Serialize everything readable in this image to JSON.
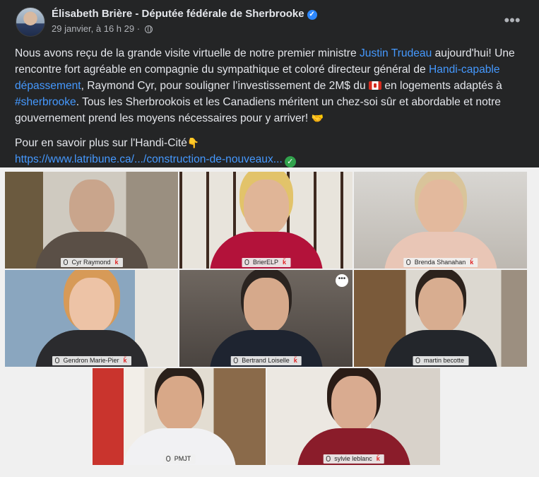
{
  "post": {
    "author": "Élisabeth Brière - Députée fédérale de Sherbrooke",
    "timestamp": "29 janvier, à 16 h 29",
    "separator": "·",
    "more_label": "•••",
    "verified_glyph": "✓",
    "paragraph1": {
      "t1": "Nous avons reçu de la grande visite virtuelle de notre premier ministre ",
      "link1": "Justin Trudeau",
      "t2": " aujourd'hui! Une rencontre fort agréable en compagnie du sympathique et coloré directeur général de ",
      "link2": "Handi-capable dépassement",
      "t3": ", Raymond Cyr, pour souligner l’investissement de 2M$ du ",
      "t4": " en logements adaptés à ",
      "link3": "#sherbrooke",
      "t5": ". Tous les Sherbrookois et les Canadiens méritent un chez-soi sûr et abordable et notre gouvernement prend les moyens nécessaires pour y arriver! ",
      "emoji_end": "🤝"
    },
    "paragraph2": {
      "text": "Pour en savoir plus sur l'Handi-Cité",
      "emoji": "👇",
      "url": "https://www.latribune.ca/.../construction-de-nouveaux...",
      "check_glyph": "✓"
    }
  },
  "icons": {
    "verified": "verified-badge-icon",
    "globe": "globe-icon",
    "more": "more-options-icon",
    "flag": "canada-flag-icon",
    "handshake": "handshake-emoji",
    "pointing": "pointing-down-emoji",
    "check": "check-mark-icon",
    "mic": "microphone-icon",
    "muted": "muted-icon"
  },
  "video_call": {
    "participants": [
      {
        "name": "Cyr Raymond",
        "muted": true
      },
      {
        "name": "BrierELP",
        "muted": true
      },
      {
        "name": "Brenda Shanahan",
        "muted": true
      },
      {
        "name": "Gendron Marie-Pier",
        "muted": true
      },
      {
        "name": "Bertrand Loiselle",
        "muted": true
      },
      {
        "name": "martin becotte",
        "muted": false
      },
      {
        "name": "PMJT",
        "muted": false,
        "active_speaker": true
      },
      {
        "name": "sylvie leblanc",
        "muted": true
      }
    ],
    "muted_glyph": "ǩ",
    "tile_menu_label": "•••"
  },
  "colors": {
    "background": "#242526",
    "text": "#e4e6eb",
    "secondary_text": "#b0b3b8",
    "link": "#4599ff",
    "verified": "#2d88ff",
    "active_speaker_border": "#2ea0e6"
  }
}
